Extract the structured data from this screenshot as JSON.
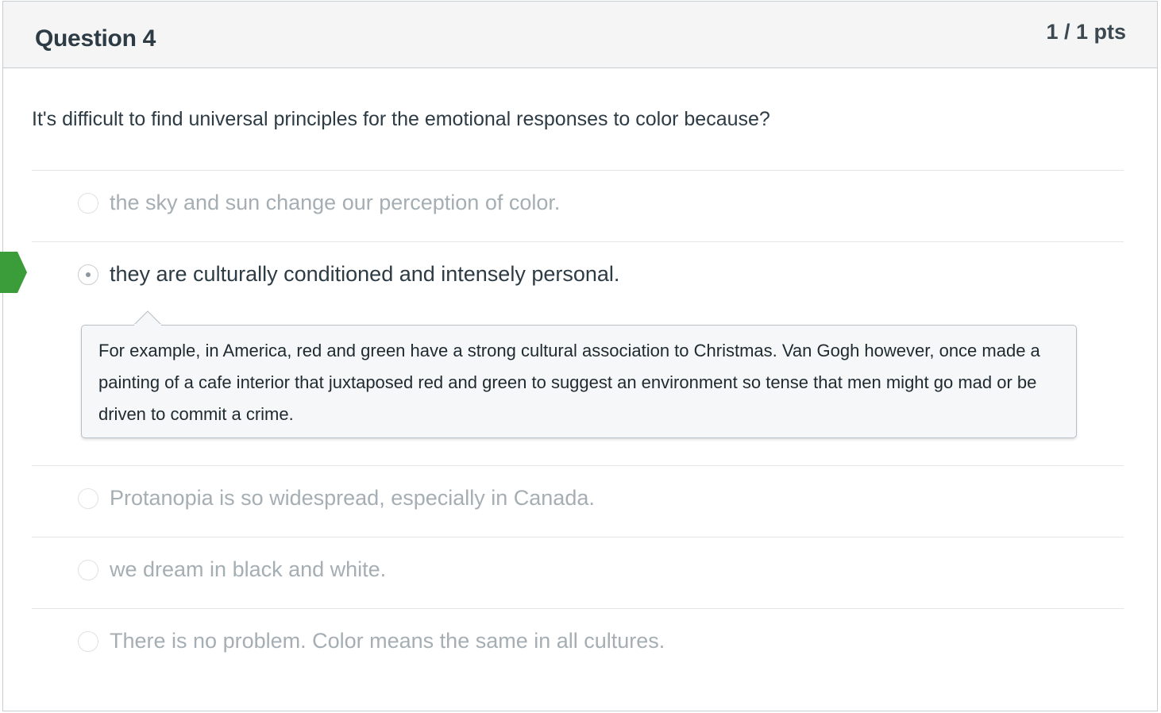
{
  "question": {
    "title": "Question 4",
    "points": "1 / 1 pts",
    "text": "It's difficult to find universal principles for the emotional responses to color because?"
  },
  "answers": [
    {
      "label": "the sky and sun change our perception of color.",
      "selected": false
    },
    {
      "label": "they are culturally conditioned and intensely personal.",
      "selected": true,
      "correct": true
    },
    {
      "label": "Protanopia is so widespread, especially in Canada.",
      "selected": false
    },
    {
      "label": "we dream in black and white.",
      "selected": false
    },
    {
      "label": "There is no problem. Color means the same in all cultures.",
      "selected": false
    }
  ],
  "comment": {
    "text": "For example, in America, red and green have a strong cultural association to Christmas. Van Gogh however, once made a painting of a cafe interior that juxtaposed red and green to suggest an environment so tense that men might go mad or be driven to commit a crime."
  },
  "colors": {
    "correct_marker": "#3a9d3a",
    "header_bg": "#f5f5f5",
    "text_dark": "#2d3b45",
    "text_muted": "#a5aeb3"
  },
  "icons": {
    "correct_marker": "correct-answer-flag-icon"
  }
}
